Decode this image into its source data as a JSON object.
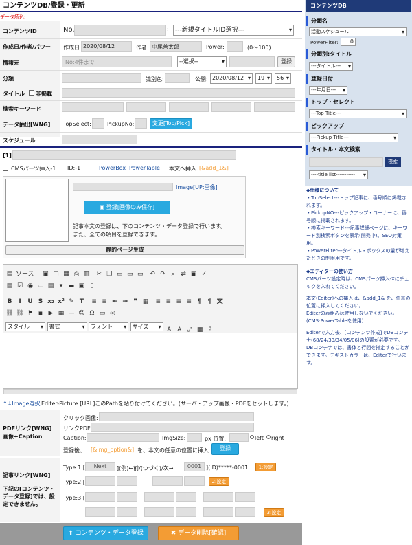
{
  "header": {
    "title": "コンテンツDB/登録・更新",
    "load_note": "データ読込:"
  },
  "fields": {
    "content_id": {
      "label": "コンテンツID",
      "no": "No.",
      "colon": ":",
      "select": "---新規タイトルID選択---"
    },
    "created": {
      "label": "作成日/作者/パワー",
      "date_label": "作成日:",
      "date": "2020/08/12",
      "author_label": "作者:",
      "author": "中尾善太郎",
      "power_label": "Power:",
      "power_range": "(0〜100)"
    },
    "source": {
      "label": "情報元",
      "placeholder": "No:4件まで",
      "select": "--選択--",
      "button": "登録"
    },
    "category": {
      "label": "分類",
      "color_label": "識別色:",
      "public_label": "公開:",
      "public_date": "2020/08/12",
      "hour": "19",
      "minute": "56"
    },
    "title_row": {
      "label": "タイトル",
      "private_label": "非掲載"
    },
    "keywords": {
      "label": "検索キーワード"
    },
    "extract": {
      "label": "データ抽出[WNG]",
      "topselect": "TopSelect:",
      "pickupno": "PickupNo:",
      "button": "変更[Top/Pick]"
    },
    "schedule": {
      "label": "スケジュール"
    }
  },
  "section": {
    "index": "[1]",
    "cms_parts": "CMSパーツ挿入-1",
    "id_label": "ID:-1",
    "powerbox": "PowerBox",
    "powertable": "PowerTable",
    "body_insert": "本文へ挿入",
    "add_tag": "[&add_1&]"
  },
  "image_block": {
    "up_label": "Image[UP:画像]",
    "register_button": "登録[画像のみ保存]",
    "desc1": "記事本文の登録は、下のコンテンツ・データ登録で行います。",
    "desc2": "また、全ての項目を登録できます。",
    "static_button": "静的ページ生成"
  },
  "editor": {
    "source": "ソース",
    "style": "スタイル",
    "format": "書式",
    "font": "フォント",
    "size": "サイズ"
  },
  "image_select": {
    "link": "↑↓Image選択",
    "note": "Editer-Picture:[URL]このPathを貼り付けてください。(サーバ・アップ画像・PDFをセットします。)"
  },
  "pdf": {
    "label1": "PDFリンク[WNG]",
    "label2": "画像+Caption",
    "click_image": "クリック画像:",
    "link_pdf": "リンクPDF:",
    "caption": "Caption:",
    "imgsize": "ImgSize:",
    "px_pos": "px 位置:",
    "left": "left",
    "right": "right",
    "after_reg": "登録後、",
    "img_option": "[&img_option&]",
    "insert_note": "を、本文の任意の位置に挿入",
    "button": "登録"
  },
  "article_link": {
    "label": "記事リンク[WNG]",
    "note": "下記の[コンテンツ・データ登録]では、設定できません。",
    "type1": "Type:1 [",
    "next": "Next",
    "type1_mid": "](例)←前/(つづく)/次→",
    "num": "0001",
    "type1_end": "](ID)*****-0001",
    "set1": "1:設定",
    "type2": "Type:2 [",
    "set2": "2:設定",
    "type3": "Type:3 [",
    "set3": "3:設定"
  },
  "footer": {
    "register": "コンテンツ・データ登録",
    "delete": "データ削除[確認]"
  },
  "sidebar": {
    "title": "コンテンツDB",
    "bunrui": "分類名",
    "bunrui_select": "活動スケジュール",
    "powerfilter_label": "PowerFilter:",
    "powerfilter": "0",
    "bunrui_title": "分類別:タイトル",
    "title_select": "---タイトル---",
    "date": "登録日付",
    "date_select": "---年月日---",
    "topselect": "トップ・セレクト",
    "top_select": "---Top Title---",
    "pickup": "ピックアップ",
    "pickup_select": "---Pickup Title---",
    "search": "タイトル・本文検索",
    "search_button": "検索",
    "title_list": "----title list-----------"
  },
  "notes": {
    "spec_title": "◆仕様について",
    "spec": [
      "・TopSelect---トップ記事に、番号順に掲載されます。",
      "・PickupNO---ピックアップ・コーナーに、番号順に掲載されます。",
      "・検索キーワード---記事詳細ページに、キーワード別検索ボタンを表示(開発中)。SEO対策用。",
      "・PowerFilter---タイトル・ボックスの量が増えたときの制限用です。"
    ],
    "editor_title": "◆エディターの使い方",
    "editor1": "CMSパーツ設定時は、CMSパーツ挿入-Xにチェックを入れてください。",
    "editor2": "本文(Editer)への挿入は、&add_1& を、任意の位置に挿入してください。",
    "editor3": "Editerの表組みは使用しないでください。(CMS:PowerTableを使用)",
    "editor4": "Editerで入力後、[コンテンツ作成]でDBコンテナ(68/24/33/34/05/06)の設置が必要です。",
    "editor5": "DBコンテナでは、書体と行間を指定することができます。テキストカラーは、Editerで行います。"
  }
}
